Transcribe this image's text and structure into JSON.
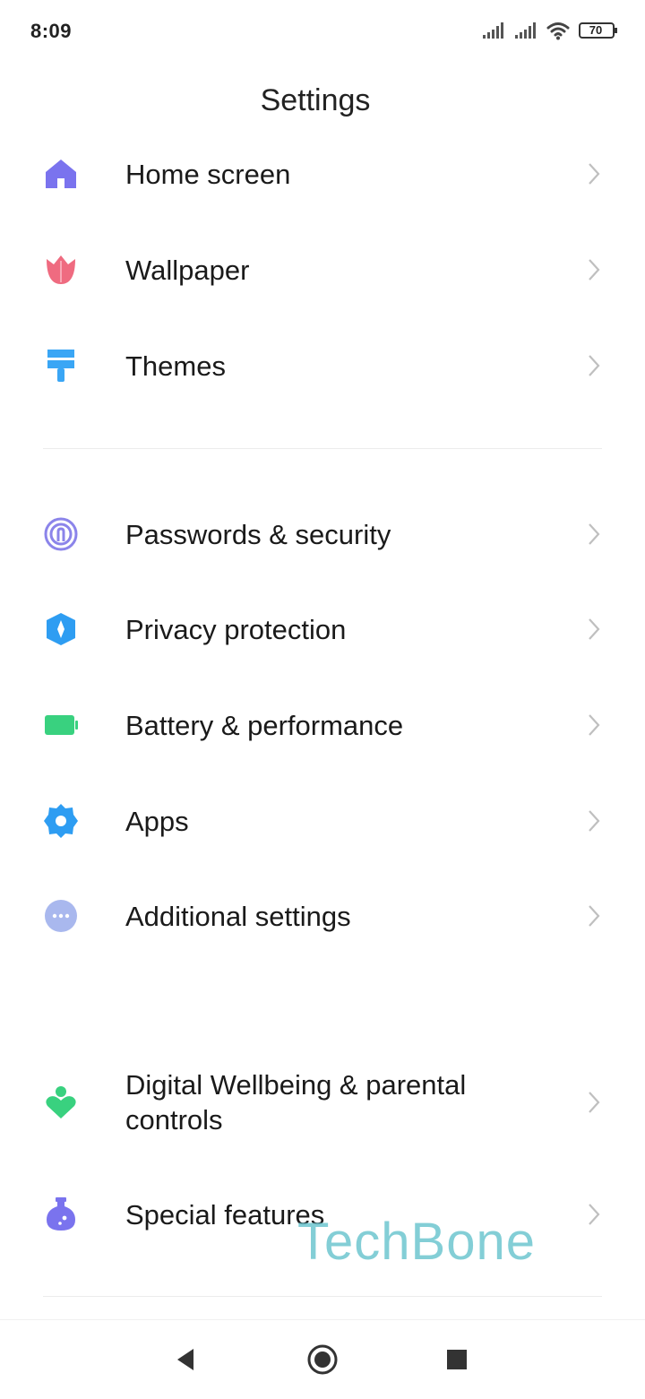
{
  "status_bar": {
    "time": "8:09",
    "battery": "70",
    "icons": [
      "signal-1-icon",
      "signal-2-icon",
      "wifi-icon",
      "battery-icon"
    ]
  },
  "title": "Settings",
  "items": [
    {
      "label": "Home screen",
      "icon": "home-icon",
      "color": "#7a73ee"
    },
    {
      "label": "Wallpaper",
      "icon": "tulip-icon",
      "color": "#ef6b80"
    },
    {
      "label": "Themes",
      "icon": "paint-roller-icon",
      "color": "#3aa6f5"
    },
    {
      "label": "Passwords & security",
      "icon": "fingerprint-icon",
      "color": "#8b84ea"
    },
    {
      "label": "Privacy protection",
      "icon": "shield-icon",
      "color": "#2e9df2"
    },
    {
      "label": "Battery & performance",
      "icon": "battery-icon",
      "color": "#39d17f"
    },
    {
      "label": "Apps",
      "icon": "gear-icon",
      "color": "#2e9df2"
    },
    {
      "label": "Additional settings",
      "icon": "more-icon",
      "color": "#a9b8ee"
    },
    {
      "label": "Digital Wellbeing & parental\ncontrols",
      "icon": "wellbeing-icon",
      "color": "#39d17f"
    },
    {
      "label": "Special features",
      "icon": "flask-icon",
      "color": "#7a73ee"
    }
  ],
  "watermark": "TechBone",
  "nav": {
    "back": "back-icon",
    "home": "home-button-icon",
    "recents": "recents-icon"
  }
}
